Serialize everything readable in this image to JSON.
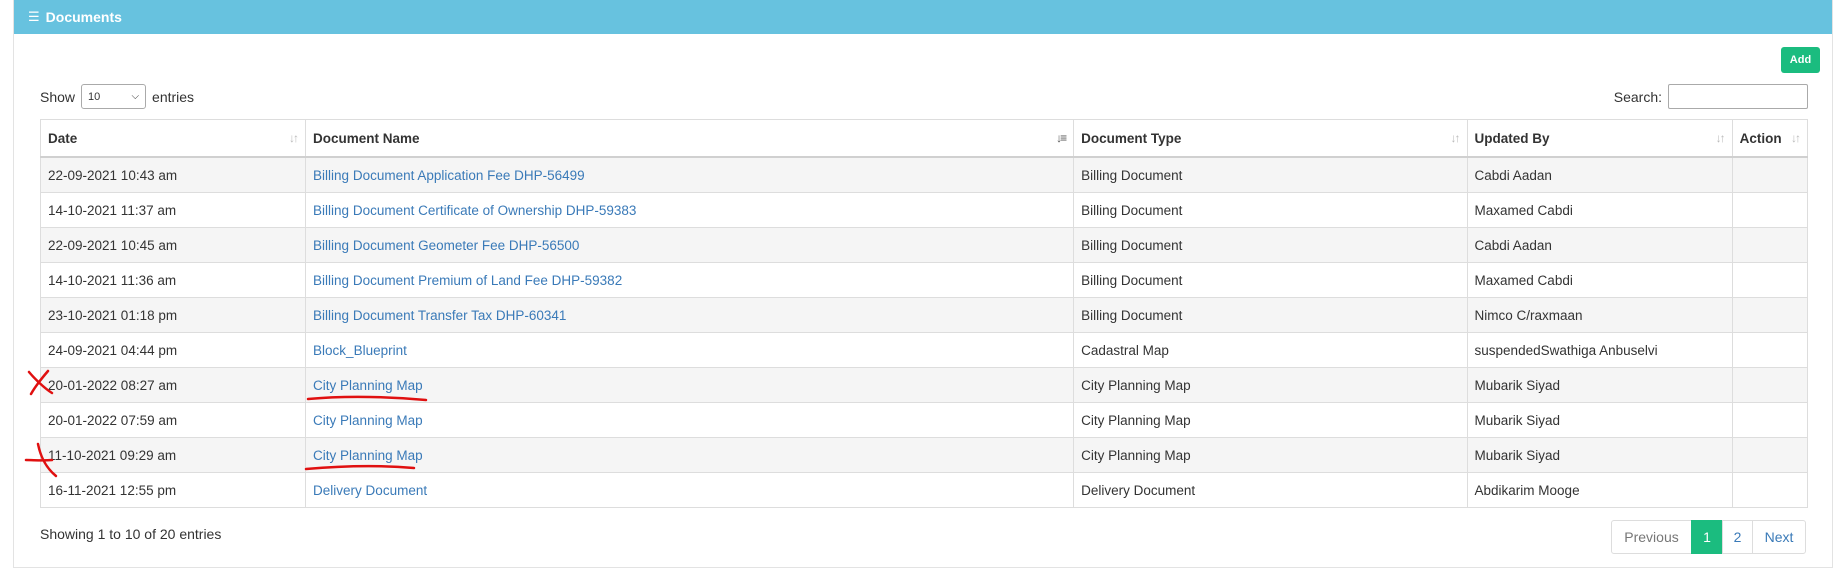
{
  "header": {
    "title": "Documents",
    "icon": "list-icon"
  },
  "toolbar": {
    "add_label": "Add"
  },
  "length": {
    "show_label": "Show",
    "entries_label": "entries",
    "selected": "10"
  },
  "search": {
    "label": "Search:",
    "value": ""
  },
  "table": {
    "columns": [
      "Date",
      "Document Name",
      "Document Type",
      "Updated By",
      "Action"
    ],
    "rows": [
      {
        "date": "22-09-2021 10:43 am",
        "name": "Billing Document Application Fee DHP-56499",
        "type": "Billing Document",
        "updated_by": "Cabdi Aadan"
      },
      {
        "date": "14-10-2021 11:37 am",
        "name": "Billing Document Certificate of Ownership DHP-59383",
        "type": "Billing Document",
        "updated_by": "Maxamed Cabdi"
      },
      {
        "date": "22-09-2021 10:45 am",
        "name": "Billing Document Geometer Fee DHP-56500",
        "type": "Billing Document",
        "updated_by": "Cabdi Aadan"
      },
      {
        "date": "14-10-2021 11:36 am",
        "name": "Billing Document Premium of Land Fee DHP-59382",
        "type": "Billing Document",
        "updated_by": "Maxamed Cabdi"
      },
      {
        "date": "23-10-2021 01:18 pm",
        "name": "Billing Document Transfer Tax DHP-60341",
        "type": "Billing Document",
        "updated_by": "Nimco C/raxmaan"
      },
      {
        "date": "24-09-2021 04:44 pm",
        "name": "Block_Blueprint",
        "type": "Cadastral Map",
        "updated_by": "suspendedSwathiga Anbuselvi"
      },
      {
        "date": "20-01-2022 08:27 am",
        "name": "City Planning Map",
        "type": "City Planning Map",
        "updated_by": "Mubarik Siyad"
      },
      {
        "date": "20-01-2022 07:59 am",
        "name": "City Planning Map",
        "type": "City Planning Map",
        "updated_by": "Mubarik Siyad"
      },
      {
        "date": "11-10-2021 09:29 am",
        "name": "City Planning Map",
        "type": "City Planning Map",
        "updated_by": "Mubarik Siyad"
      },
      {
        "date": "16-11-2021 12:55 pm",
        "name": "Delivery Document",
        "type": "Delivery Document",
        "updated_by": "Abdikarim Mooge"
      }
    ]
  },
  "footer": {
    "info": "Showing 1 to 10 of 20 entries"
  },
  "pagination": {
    "previous": "Previous",
    "pages": [
      "1",
      "2"
    ],
    "current": "1",
    "next": "Next"
  },
  "colors": {
    "header_bg": "#67c2df",
    "accent_green": "#1bbc7f",
    "link": "#3a7ab8",
    "annotation_red": "#e01010"
  },
  "annotations": {
    "marked_rows": [
      7,
      9
    ],
    "mark": "red-x-and-underline"
  }
}
